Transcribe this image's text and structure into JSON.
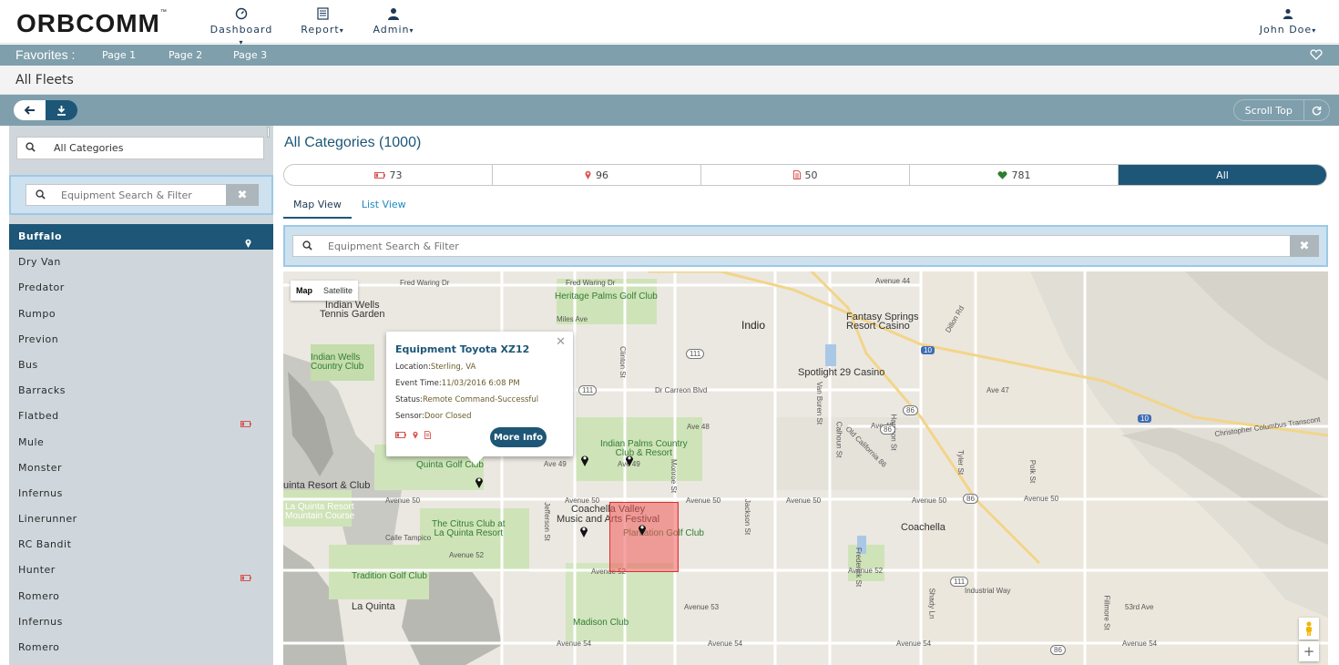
{
  "app": {
    "logo": "ORBCOMM",
    "logo_tm": "™"
  },
  "nav": {
    "dashboard": "Dashboard",
    "report": "Report",
    "admin": "Admin",
    "user": "John Doe"
  },
  "favorites": {
    "title": "Favorites :",
    "pages": [
      "Page 1",
      "Page 2",
      "Page 3"
    ]
  },
  "page_title": "All Fleets",
  "toolbar": {
    "scroll_top": "Scroll Top"
  },
  "sidebar": {
    "search_value": "All Categories",
    "filter_placeholder": "Equipment Search & Filter",
    "items": [
      {
        "label": "Buffalo",
        "active": true,
        "icon": "map-marker-icon"
      },
      {
        "label": "Dry Van"
      },
      {
        "label": "Predator"
      },
      {
        "label": "Rumpo"
      },
      {
        "label": "Previon"
      },
      {
        "label": "Bus"
      },
      {
        "label": "Barracks"
      },
      {
        "label": "Flatbed",
        "icon": "battery-icon"
      },
      {
        "label": "Mule"
      },
      {
        "label": "Monster"
      },
      {
        "label": "Infernus"
      },
      {
        "label": "Linerunner"
      },
      {
        "label": "RC Bandit"
      },
      {
        "label": "Hunter",
        "icon": "battery-icon"
      },
      {
        "label": "Romero"
      },
      {
        "label": "Infernus"
      },
      {
        "label": "Romero"
      }
    ]
  },
  "main": {
    "title": "All Categories (1000)",
    "stat_tabs": [
      {
        "label": "73",
        "icon": "battery-icon",
        "color": "#d9534f"
      },
      {
        "label": "96",
        "icon": "map-marker-icon",
        "color": "#d9534f"
      },
      {
        "label": "50",
        "icon": "document-icon",
        "color": "#d9534f"
      },
      {
        "label": "781",
        "icon": "heart-icon",
        "color": "#2e7d32"
      },
      {
        "label": "All",
        "active": true
      }
    ],
    "view_tabs": [
      "Map View",
      "List View"
    ],
    "filter_placeholder": "Equipment Search & Filter"
  },
  "map": {
    "type_buttons": [
      "Map",
      "Satellite"
    ],
    "labels": {
      "fred_waring_1": "Fred Waring Dr",
      "fred_waring_2": "Fred Waring Dr",
      "heritage_palms": "Heritage Palms Golf Club",
      "indian_wells_tennis": "Indian Wells\nTennis Garden",
      "miles_ave": "Miles Ave",
      "indio": "Indio",
      "fantasy_springs": "Fantasy Springs\nResort Casino",
      "avenue_44": "Avenue 44",
      "indian_wells_cc": "Indian Wells\nCountry Club",
      "spotlight_29": "Spotlight 29 Casino",
      "dr_carreon": "Dr Carreon Blvd",
      "avenue_47": "Ave 47",
      "ave_48": "Ave 48",
      "avenue_48": "Ave 48",
      "christopher_columbus": "Christopher Columbus Transcont",
      "indian_palms": "Indian Palms Country\nClub & Resort",
      "ave_49_1": "Ave 49",
      "ave_49_2": "Ave 49",
      "quinta_golf": "Quinta Golf Club",
      "quinta_resort": "uinta Resort & Club",
      "la_quinta_resort_course": "La Quinta Resort\nMountain Course",
      "avenue_50_1": "Avenue 50",
      "avenue_50_2": "Avenue 50",
      "avenue_50_3": "Avenue 50",
      "avenue_50_4": "Avenue 50",
      "avenue_50_5": "Avenue 50",
      "avenue_50_6": "Avenue 50",
      "coachella_festival": "Coachella Valley\nMusic and Arts Festival",
      "coachella": "Coachella",
      "citrus_club": "The Citrus Club at\nLa Quinta Resort",
      "plantation_golf": "Plantation Golf Club",
      "calle_tampico": "Calle Tampico",
      "avenue_52_1": "Avenue 52",
      "avenue_52_2": "Avenue 52",
      "avenue_52_3": "Avenue 52",
      "tradition_golf": "Tradition Golf Club",
      "la_quinta": "La Quinta",
      "madison_club": "Madison Club",
      "avenue_53": "Avenue 53",
      "avenue_54_1": "Avenue 54",
      "avenue_54_2": "Avenue 54",
      "avenue_54_3": "Avenue 54",
      "avenue_54_4": "Avenue 54",
      "industrial_way": "Industrial Way",
      "53rd_ave": "53rd Ave",
      "calhoun_st": "Calhoun St",
      "van_buren": "Van Buren St",
      "jackson_st": "Jackson St",
      "monroe_st": "Monroe St",
      "jefferson_st": "Jefferson St",
      "clinton_st": "Clinton St",
      "dillon_rd": "Dillon Rd",
      "old_california_86": "Old California 86",
      "tyler_st": "Tyler St",
      "polk_st": "Polk St",
      "fillmore_st": "Fillmore St",
      "harrison_st": "Harrison St",
      "frederick_st": "Frederick St",
      "shady_ln": "Shady Ln",
      "route_111_1": "111",
      "route_111_2": "111",
      "route_111_3": "111",
      "route_86_1": "86",
      "route_86_2": "86",
      "route_86_3": "86",
      "route_86_4": "86",
      "route_10_1": "10",
      "route_10_2": "10"
    },
    "popup": {
      "title": "Equipment Toyota XZ12",
      "location_label": "Location:",
      "location": "Sterling, VA",
      "event_time_label": "Event Time:",
      "event_time": "11/03/2016 6:08 PM",
      "status_label": "Status:",
      "status": "Remote Command-Successful",
      "sensor_label": "Sensor:",
      "sensor": "Door Closed",
      "more_info": "More Info"
    },
    "zoom_in": "+"
  }
}
